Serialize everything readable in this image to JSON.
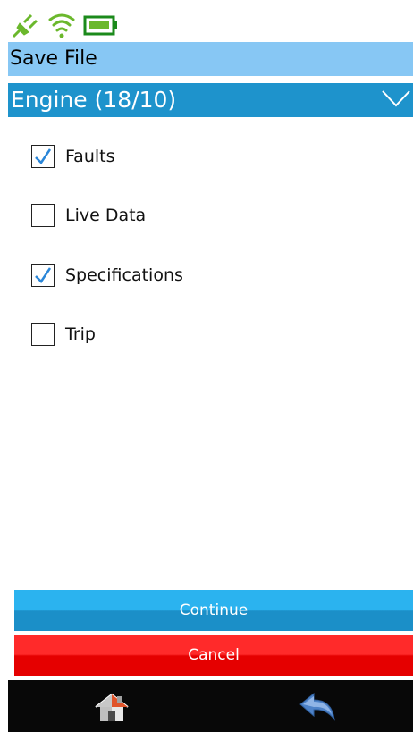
{
  "status_bar": {
    "icons": [
      "plug-icon",
      "wifi-icon",
      "battery-icon"
    ],
    "plug_color": "#6bb82c",
    "wifi_color": "#6bb82c",
    "battery_color": "#1b8a1b"
  },
  "header": {
    "title": "Save File"
  },
  "module_select": {
    "selected": "Engine (18/10)"
  },
  "options": [
    {
      "label": "Faults",
      "checked": true
    },
    {
      "label": "Live Data",
      "checked": false
    },
    {
      "label": "Specifications",
      "checked": true
    },
    {
      "label": "Trip",
      "checked": false
    }
  ],
  "buttons": {
    "continue_label": "Continue",
    "cancel_label": "Cancel"
  },
  "nav": {
    "icons": [
      "home-icon",
      "back-arrow-icon"
    ]
  },
  "colors": {
    "title_bar": "#87c7f4",
    "dropdown": "#1e93cc",
    "continue": "#2bb3ef",
    "cancel": "#ff2a2a",
    "checkmark": "#2a86d8",
    "nav_bar": "#080808"
  }
}
